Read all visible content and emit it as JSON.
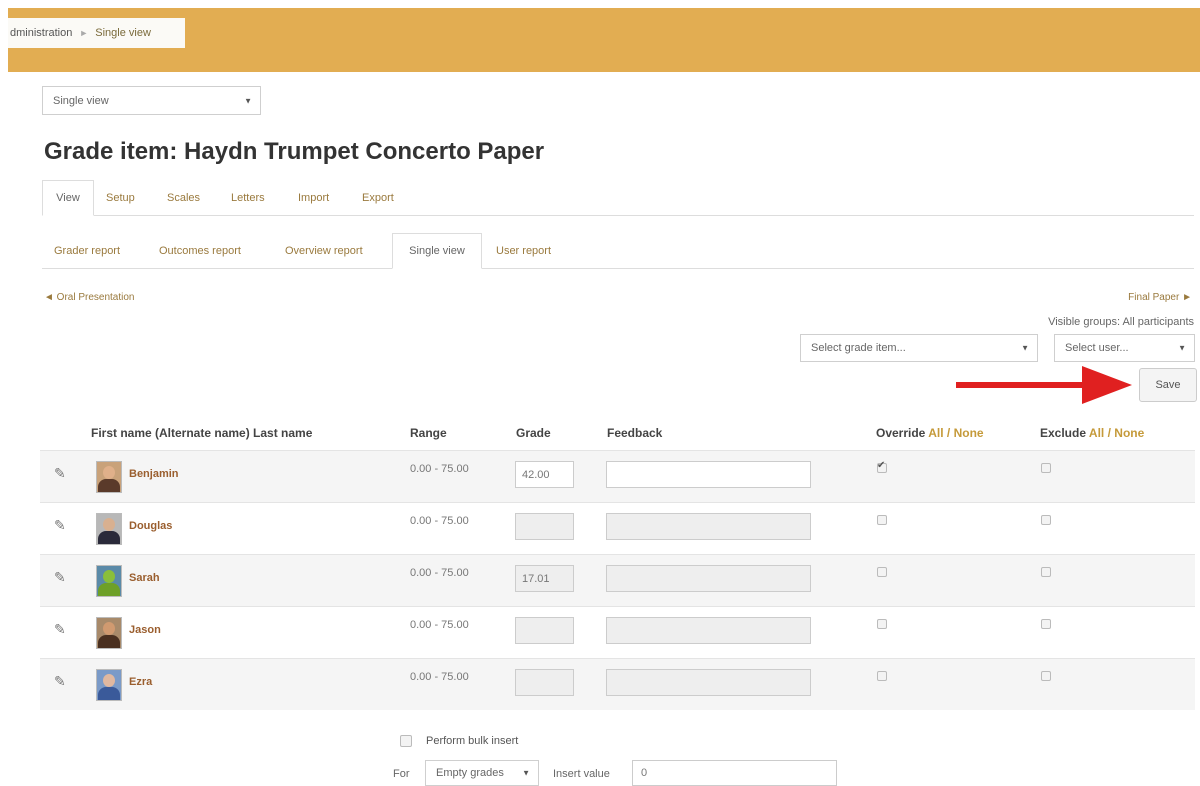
{
  "breadcrumb": {
    "parent": "dministration",
    "separator": "►",
    "current": "Single view"
  },
  "view_selector": {
    "value": "Single view"
  },
  "page_title": "Grade item: Haydn Trumpet Concerto Paper",
  "main_tabs": [
    "View",
    "Setup",
    "Scales",
    "Letters",
    "Import",
    "Export"
  ],
  "sub_tabs": [
    "Grader report",
    "Outcomes report",
    "Overview report",
    "Single view",
    "User report"
  ],
  "nav": {
    "prev": "◄ Oral Presentation",
    "next": "Final Paper ►"
  },
  "visible_groups": "Visible groups: All participants",
  "grade_item_select": {
    "placeholder": "Select grade item..."
  },
  "user_select": {
    "placeholder": "Select user..."
  },
  "save_label": "Save",
  "table": {
    "headers": {
      "name": "First name (Alternate name) Last name",
      "range": "Range",
      "grade": "Grade",
      "feedback": "Feedback",
      "override": "Override",
      "exclude": "Exclude",
      "all": "All",
      "slash": " / ",
      "none": "None"
    },
    "rows": [
      {
        "name": "Benjamin",
        "range": "0.00 - 75.00",
        "grade": "42.00",
        "override": true,
        "exclude": false,
        "enabled": true
      },
      {
        "name": "Douglas",
        "range": "0.00 - 75.00",
        "grade": "",
        "override": false,
        "exclude": false,
        "enabled": false
      },
      {
        "name": "Sarah",
        "range": "0.00 - 75.00",
        "grade": "17.01",
        "override": false,
        "exclude": false,
        "enabled": false
      },
      {
        "name": "Jason",
        "range": "0.00 - 75.00",
        "grade": "",
        "override": false,
        "exclude": false,
        "enabled": false
      },
      {
        "name": "Ezra",
        "range": "0.00 - 75.00",
        "grade": "",
        "override": false,
        "exclude": false,
        "enabled": false
      }
    ]
  },
  "bulk": {
    "label": "Perform bulk insert",
    "for_label": "For",
    "for_value": "Empty grades",
    "insert_label": "Insert value",
    "insert_value": "0"
  },
  "colors": {
    "header_bar": "#e2ad52",
    "link": "#9a7a3e",
    "arrow": "#e02020"
  },
  "icons": {
    "edit": "pencil-icon",
    "caret": "caret-down-icon",
    "arrow": "red-arrow-annotation"
  }
}
